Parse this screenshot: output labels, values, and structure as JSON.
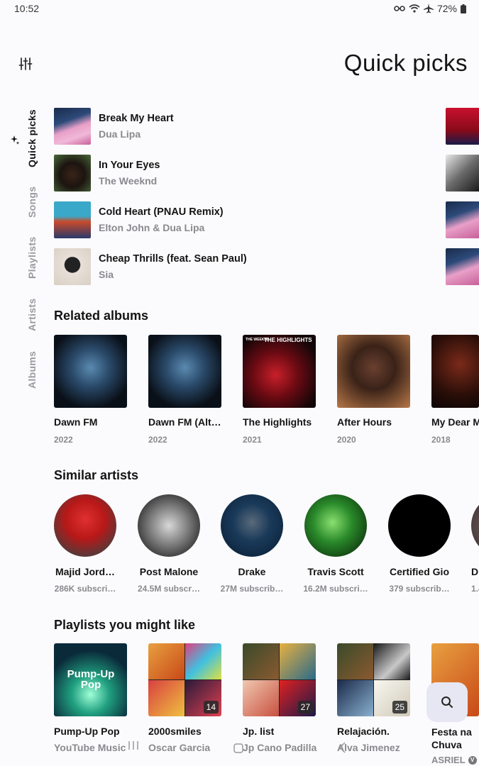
{
  "status": {
    "time": "10:52",
    "battery": "72%"
  },
  "header": {
    "title": "Quick picks"
  },
  "side_nav": [
    {
      "label": "Quick picks",
      "active": true
    },
    {
      "label": "Songs",
      "active": false
    },
    {
      "label": "Playlists",
      "active": false
    },
    {
      "label": "Artists",
      "active": false
    },
    {
      "label": "Albums",
      "active": false
    }
  ],
  "quick_picks": [
    {
      "title": "Break My Heart",
      "artist": "Dua Lipa"
    },
    {
      "title": "In Your Eyes",
      "artist": "The Weeknd"
    },
    {
      "title": "Cold Heart (PNAU Remix)",
      "artist": "Elton John & Dua Lipa"
    },
    {
      "title": "Cheap Thrills (feat. Sean Paul)",
      "artist": "Sia"
    }
  ],
  "related_albums": {
    "title": "Related albums",
    "items": [
      {
        "title": "Dawn FM",
        "year": "2022"
      },
      {
        "title": "Dawn FM (Alt…",
        "year": "2022"
      },
      {
        "title": "The Highlights",
        "year": "2021",
        "art_text": "THE HIGHLIGHTS",
        "art_subtext": "THE WEEKND"
      },
      {
        "title": "After Hours",
        "year": "2020"
      },
      {
        "title": "My Dear M",
        "year": "2018"
      }
    ]
  },
  "similar_artists": {
    "title": "Similar artists",
    "items": [
      {
        "name": "Majid Jord…",
        "subs": "286K subscri…"
      },
      {
        "name": "Post Malone",
        "subs": "24.5M subscr…"
      },
      {
        "name": "Drake",
        "subs": "27M subscrib…"
      },
      {
        "name": "Travis Scott",
        "subs": "16.2M subscri…"
      },
      {
        "name": "Certified Gio",
        "subs": "379 subscrib…"
      },
      {
        "name": "D",
        "subs": "1.4"
      }
    ]
  },
  "playlists": {
    "title": "Playlists you might like",
    "items": [
      {
        "title": "Pump-Up Pop",
        "owner": "YouTube Music",
        "art_text": "Pump-Up Pop",
        "count": ""
      },
      {
        "title": "2000smiles",
        "owner": "Oscar Garcia",
        "count": "14"
      },
      {
        "title": "Jp. list",
        "owner": "Jp Cano Padilla",
        "count": "27"
      },
      {
        "title": "Relajación.",
        "owner": "Alva Jimenez",
        "count": "25"
      },
      {
        "title": "Festa na Chuva",
        "owner": "ASRIEL",
        "count": ""
      }
    ]
  },
  "icons": {
    "filter": "filter-sliders-icon",
    "sparkle": "sparkle-icon",
    "search": "search-icon"
  }
}
